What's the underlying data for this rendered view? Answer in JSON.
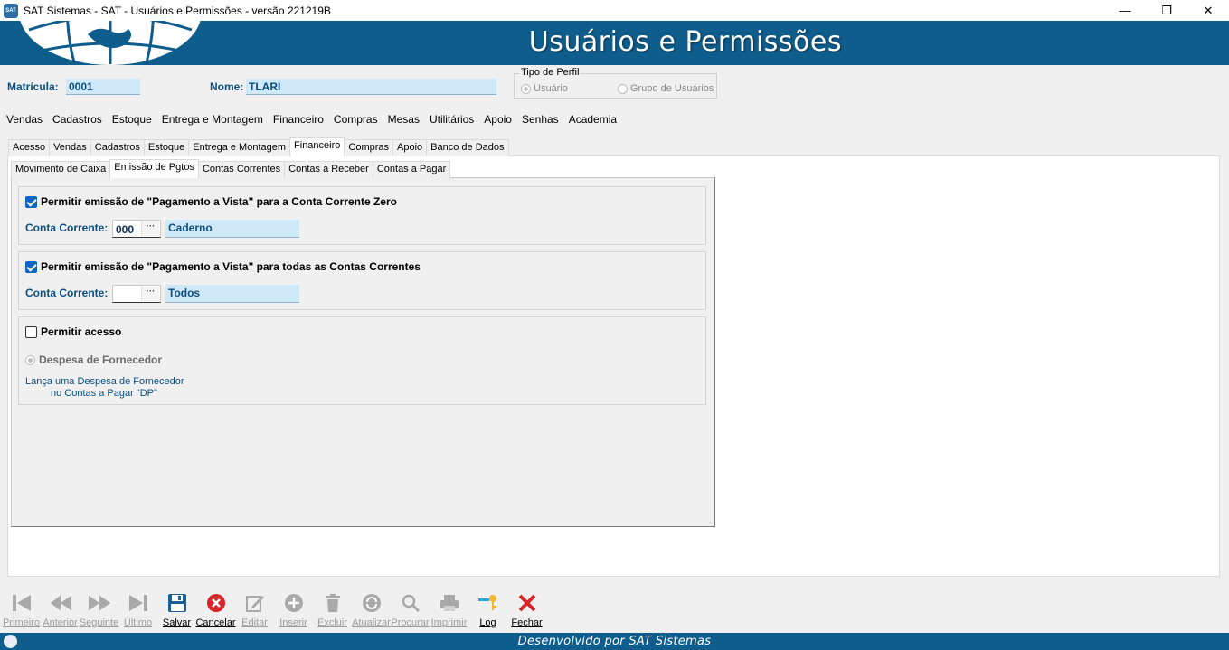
{
  "window": {
    "title": "SAT Sistemas - SAT - Usuários e Permissões - versão 221219B",
    "icon_text": "SAT",
    "min_glyph": "—",
    "max_glyph": "❐",
    "close_glyph": "✕"
  },
  "header": {
    "title": "Usuários e Permissões"
  },
  "user": {
    "matricula_label": "Matrícula:",
    "matricula_value": "0001",
    "nome_label": "Nome:",
    "nome_value": "TLARI"
  },
  "perfil": {
    "legend": "Tipo de Perfil",
    "options": [
      {
        "label": "Usuário",
        "selected": true
      },
      {
        "label": "Grupo de Usuários",
        "selected": false
      }
    ]
  },
  "menu": [
    "Vendas",
    "Cadastros",
    "Estoque",
    "Entrega e Montagem",
    "Financeiro",
    "Compras",
    "Mesas",
    "Utilitários",
    "Apoio",
    "Senhas",
    "Academia"
  ],
  "tabs_level1": [
    "Acesso",
    "Vendas",
    "Cadastros",
    "Estoque",
    "Entrega e Montagem",
    "Financeiro",
    "Compras",
    "Apoio",
    "Banco de Dados"
  ],
  "tabs_level1_active": "Financeiro",
  "tabs_level2": [
    "Movimento de Caixa",
    "Emissão de Pgtos",
    "Contas Correntes",
    "Contas à Receber",
    "Contas a Pagar"
  ],
  "tabs_level2_active": "Emissão de Pgtos",
  "group1": {
    "checkbox_label": "Permitir emissão de \"Pagamento a Vista\" para a Conta Corrente Zero",
    "checked": true,
    "cc_label": "Conta Corrente:",
    "cc_code": "000",
    "cc_name": "Caderno",
    "dots": "···"
  },
  "group2": {
    "checkbox_label": "Permitir emissão de \"Pagamento a Vista\" para todas as Contas Correntes",
    "checked": true,
    "cc_label": "Conta Corrente:",
    "cc_code": "",
    "cc_name": "Todos",
    "dots": "···"
  },
  "group3": {
    "checkbox_label": "Permitir acesso",
    "checked": false,
    "radio_label": "Despesa de Fornecedor",
    "desc_line1": "Lança uma Despesa de Fornecedor",
    "desc_line2": "no Contas a Pagar \"DP\""
  },
  "toolbar": [
    {
      "label": "Primeiro",
      "icon": "first-icon",
      "enabled": false
    },
    {
      "label": "Anterior",
      "icon": "previous-icon",
      "enabled": false
    },
    {
      "label": "Seguinte",
      "icon": "next-icon",
      "enabled": false
    },
    {
      "label": "Último",
      "icon": "last-icon",
      "enabled": false
    },
    {
      "label": "Salvar",
      "icon": "save-icon",
      "enabled": true
    },
    {
      "label": "Cancelar",
      "icon": "cancel-icon",
      "enabled": true
    },
    {
      "label": "Editar",
      "icon": "edit-icon",
      "enabled": false
    },
    {
      "label": "Inserir",
      "icon": "insert-icon",
      "enabled": false
    },
    {
      "label": "Excluir",
      "icon": "delete-icon",
      "enabled": false
    },
    {
      "label": "Atualizar",
      "icon": "refresh-icon",
      "enabled": false
    },
    {
      "label": "Procurar",
      "icon": "search-icon",
      "enabled": false
    },
    {
      "label": "Imprimir",
      "icon": "print-icon",
      "enabled": false
    },
    {
      "label": "Log",
      "icon": "log-icon",
      "enabled": true
    },
    {
      "label": "Fechar",
      "icon": "close-icon",
      "enabled": true
    }
  ],
  "colors": {
    "brand_blue": "#0f5d8c",
    "field_blue": "#cfe9f9",
    "label_blue": "#0b4f80",
    "cancel_red": "#d6262a"
  },
  "footer": {
    "text": "Desenvolvido por SAT Sistemas"
  }
}
